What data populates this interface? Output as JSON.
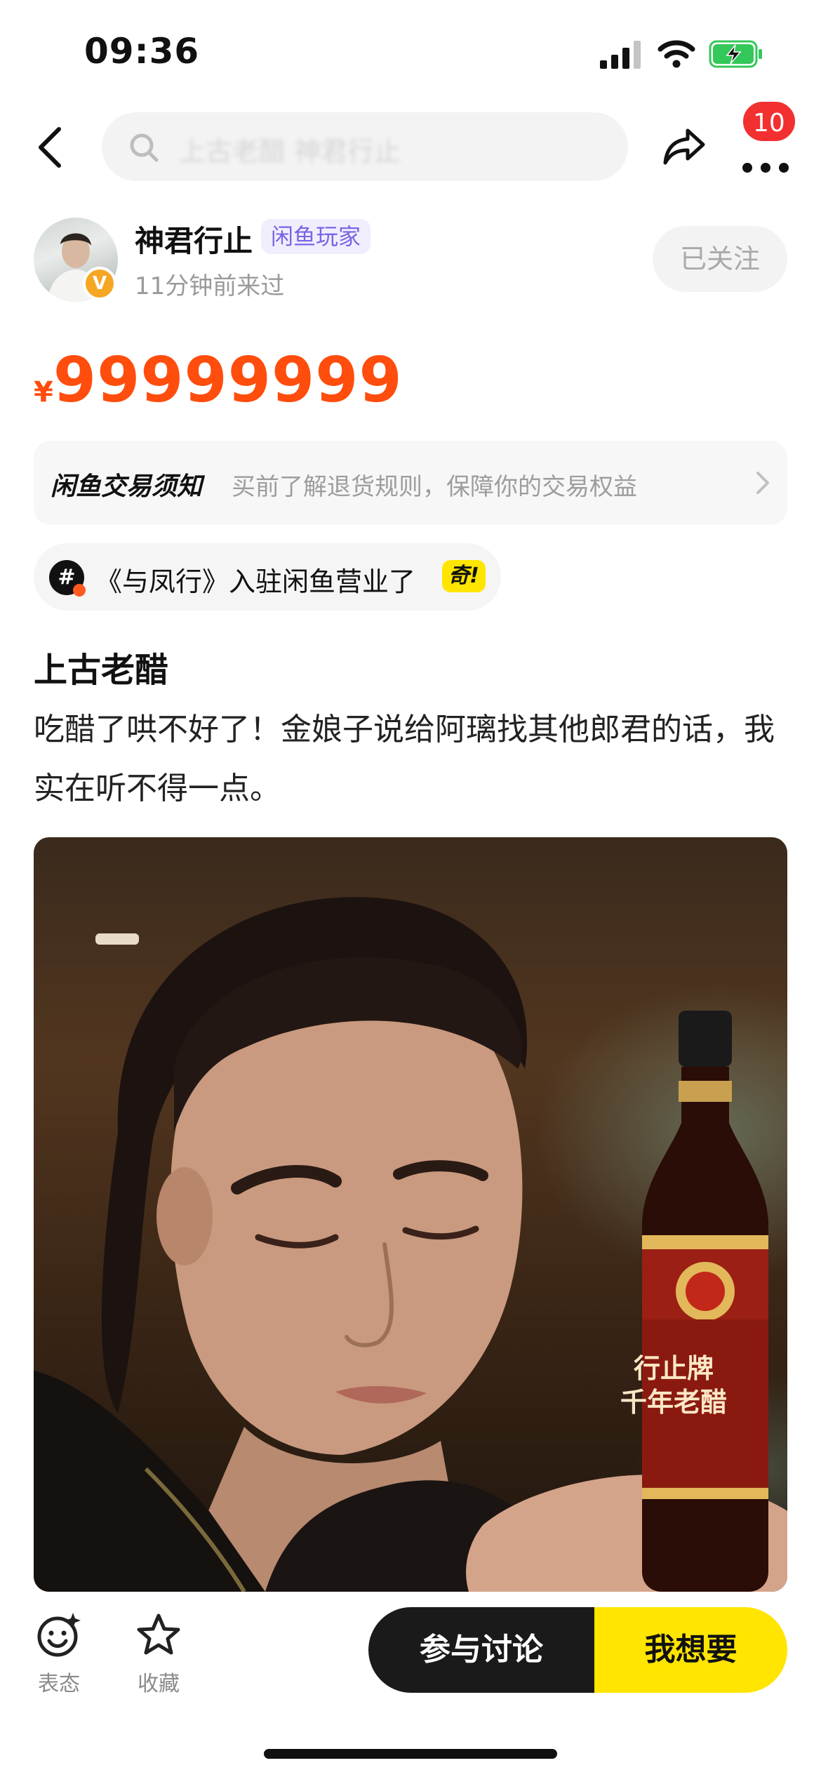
{
  "status_bar": {
    "time": "09:36",
    "icons": [
      "cellular-signal-icon",
      "wifi-icon",
      "battery-charging-icon"
    ],
    "battery_color": "#34c759"
  },
  "nav": {
    "search_placeholder": "上古老醋 神君行止",
    "notification_badge": "10",
    "icons": [
      "back-arrow-icon",
      "search-icon",
      "share-icon",
      "more-icon"
    ]
  },
  "seller": {
    "name": "神君行止",
    "tag": "闲鱼玩家",
    "last_seen": "11分钟前来过",
    "verified_badge": "V",
    "follow_label": "已关注"
  },
  "price": {
    "symbol": "¥",
    "value": "99999999",
    "color": "#ff4d0d"
  },
  "notice": {
    "title": "闲鱼交易须知",
    "text": "买前了解退货规则，保障你的交易权益"
  },
  "topic": {
    "icon_text": "#",
    "text": "《与凤行》入驻闲鱼营业了",
    "tag": "奇!"
  },
  "item": {
    "title": "上古老醋",
    "description": "吃醋了哄不好了！金娘子说给阿璃找其他郎君的话，我实在听不得一点。",
    "image_caption_line1": "行止牌",
    "image_caption_line2": "千年老醋"
  },
  "bottom_bar": {
    "react_label": "表态",
    "favorite_label": "收藏",
    "discuss_label": "参与讨论",
    "want_label": "我想要",
    "accent_color": "#ffe500"
  }
}
